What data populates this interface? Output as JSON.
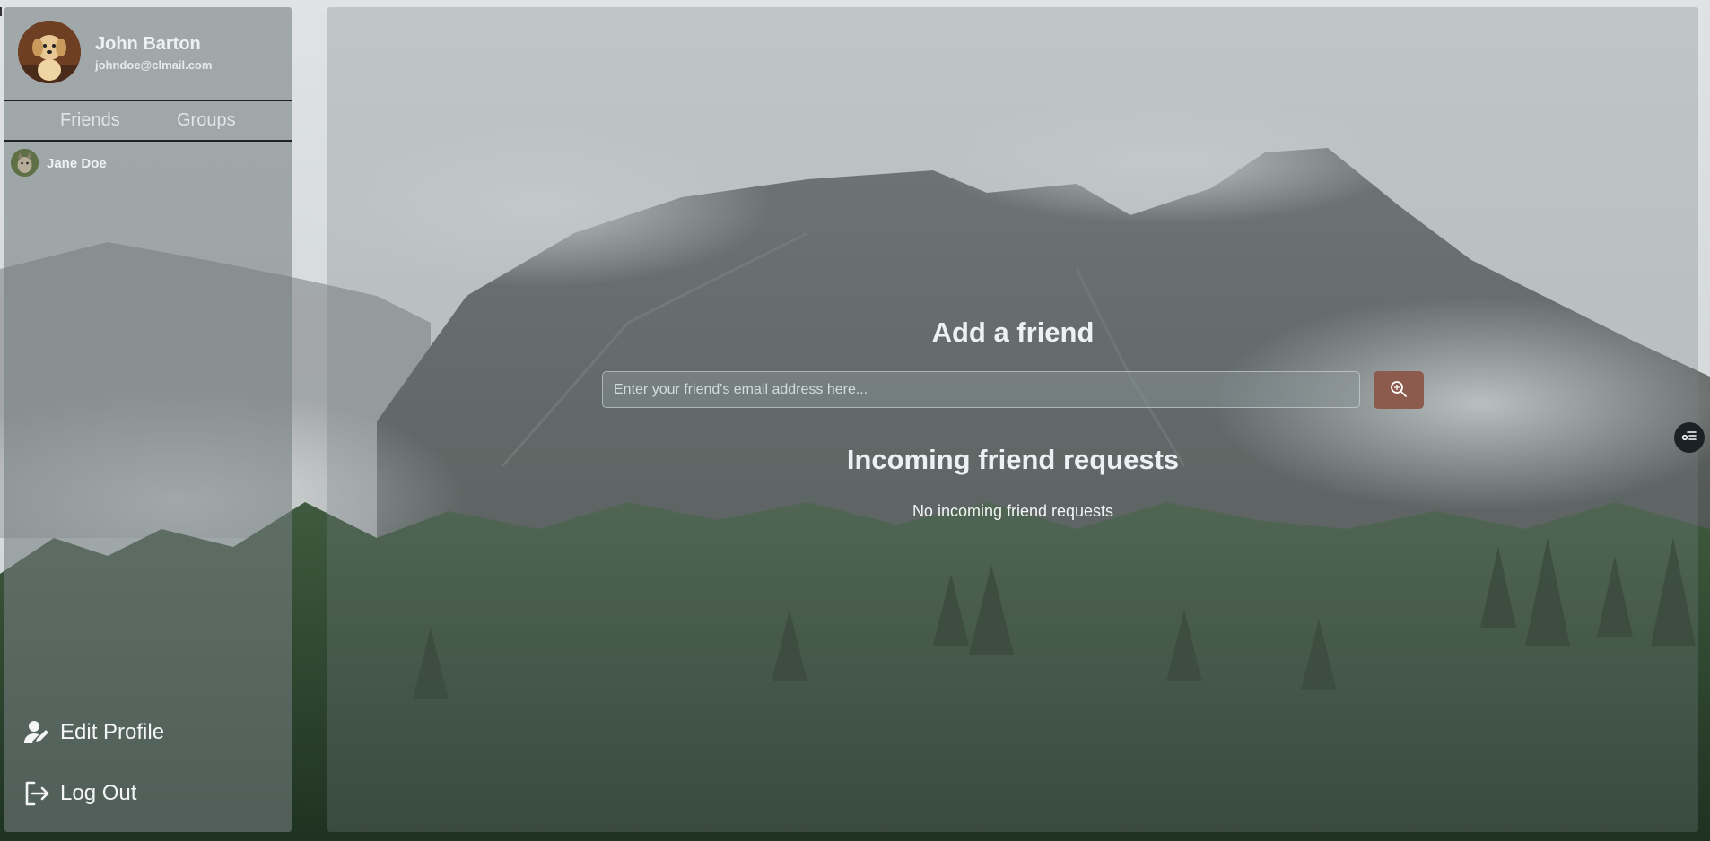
{
  "user": {
    "name": "John Barton",
    "email": "johndoe@clmail.com"
  },
  "tabs": [
    {
      "label": "Friends"
    },
    {
      "label": "Groups"
    }
  ],
  "friends": [
    {
      "name": "Jane Doe"
    }
  ],
  "sidebar_actions": {
    "edit_profile": "Edit Profile",
    "log_out": "Log Out"
  },
  "add_friend": {
    "title": "Add a friend",
    "placeholder": "Enter your friend's email address here...",
    "search_icon": "search-icon",
    "button_color": "#8c5b4d"
  },
  "incoming": {
    "title": "Incoming friend requests",
    "empty_text": "No incoming friend requests"
  },
  "floating_button_icon": "list-settings-icon"
}
